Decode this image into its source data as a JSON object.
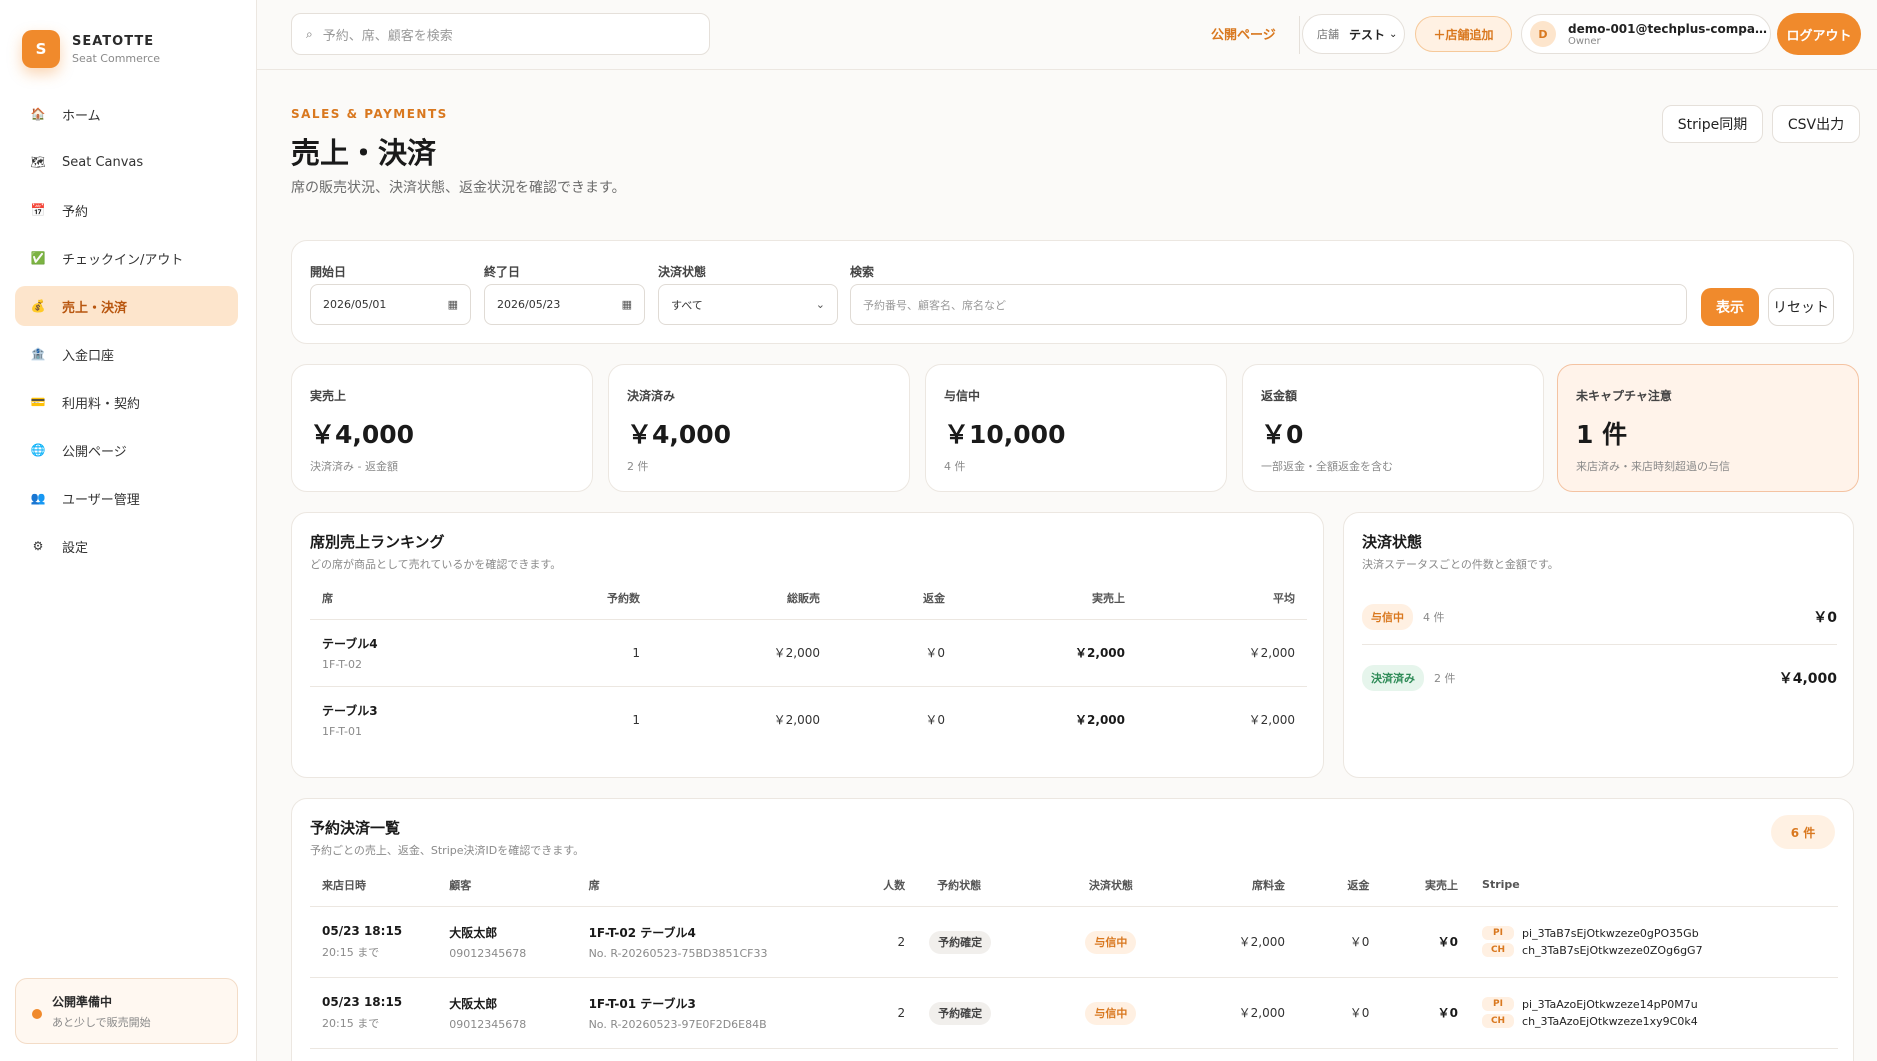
{
  "brand": {
    "logo_letter": "S",
    "name": "SEATOTTE",
    "sub": "Seat Commerce"
  },
  "nav": [
    {
      "label": "ホーム",
      "icon": "home-icon",
      "glyph": "🏠"
    },
    {
      "label": "Seat Canvas",
      "icon": "map-icon",
      "glyph": "🗺"
    },
    {
      "label": "予約",
      "icon": "calendar-icon",
      "glyph": "📅"
    },
    {
      "label": "チェックイン/アウト",
      "icon": "check-icon",
      "glyph": "✅"
    },
    {
      "label": "売上・決済",
      "icon": "money-bag-icon",
      "glyph": "💰",
      "active": true
    },
    {
      "label": "入金口座",
      "icon": "bank-icon",
      "glyph": "🏦"
    },
    {
      "label": "利用料・契約",
      "icon": "credit-card-icon",
      "glyph": "💳"
    },
    {
      "label": "公開ページ",
      "icon": "globe-icon",
      "glyph": "🌐"
    },
    {
      "label": "ユーザー管理",
      "icon": "users-icon",
      "glyph": "👥"
    },
    {
      "label": "設定",
      "icon": "gear-icon",
      "glyph": "⚙"
    }
  ],
  "publish_status": {
    "title": "公開準備中",
    "sub": "あと少しで販売開始"
  },
  "topbar": {
    "search_placeholder": "予約、席、顧客を検索",
    "public_page": "公開ページ",
    "store_label": "店舗",
    "store_value": "テスト",
    "add_store": "＋店舗追加",
    "user_initial": "D",
    "user_email": "demo-001@techplus-compan...",
    "user_role": "Owner",
    "logout": "ログアウト"
  },
  "header": {
    "eyebrow": "SALES & PAYMENTS",
    "title": "売上・決済",
    "desc": "席の販売状況、決済状態、返金状況を確認できます。",
    "stripe_sync": "Stripe同期",
    "csv_export": "CSV出力"
  },
  "filter": {
    "start_label": "開始日",
    "start_value": "2026/05/01",
    "end_label": "終了日",
    "end_value": "2026/05/23",
    "status_label": "決済状態",
    "status_value": "すべて",
    "search_label": "検索",
    "search_placeholder": "予約番号、顧客名、席名など",
    "show": "表示",
    "reset": "リセット"
  },
  "stats": [
    {
      "label": "実売上",
      "value": "￥4,000",
      "sub": "決済済み - 返金額"
    },
    {
      "label": "決済済み",
      "value": "￥4,000",
      "sub": "2 件"
    },
    {
      "label": "与信中",
      "value": "￥10,000",
      "sub": "4 件"
    },
    {
      "label": "返金額",
      "value": "￥0",
      "sub": "一部返金・全額返金を含む"
    },
    {
      "label": "未キャプチャ注意",
      "value": "1 件",
      "sub": "来店済み・来店時刻超過の与信"
    }
  ],
  "ranking": {
    "title": "席別売上ランキング",
    "desc": "どの席が商品として売れているかを確認できます。",
    "headers": [
      "席",
      "予約数",
      "総販売",
      "返金",
      "実売上",
      "平均"
    ],
    "rows": [
      {
        "name": "テーブル4",
        "code": "1F-T-02",
        "count": "1",
        "gross": "￥2,000",
        "refund": "￥0",
        "net": "￥2,000",
        "avg": "￥2,000"
      },
      {
        "name": "テーブル3",
        "code": "1F-T-01",
        "count": "1",
        "gross": "￥2,000",
        "refund": "￥0",
        "net": "￥2,000",
        "avg": "￥2,000"
      }
    ]
  },
  "payment_status": {
    "title": "決済状態",
    "desc": "決済ステータスごとの件数と金額です。",
    "rows": [
      {
        "label": "与信中",
        "count": "4 件",
        "amount": "￥0",
        "color": "orange"
      },
      {
        "label": "決済済み",
        "count": "2 件",
        "amount": "￥4,000",
        "color": "green"
      }
    ]
  },
  "list": {
    "title": "予約決済一覧",
    "desc": "予約ごとの売上、返金、Stripe決済IDを確認できます。",
    "count": "6 件",
    "headers": [
      "来店日時",
      "顧客",
      "席",
      "人数",
      "予約状態",
      "決済状態",
      "席料金",
      "返金",
      "実売上",
      "Stripe"
    ],
    "rows": [
      {
        "date": "05/23 18:15",
        "until": "20:15 まで",
        "customer": "大阪太郎",
        "phone": "09012345678",
        "seat": "1F-T-02 テーブル4",
        "resno": "No. R-20260523-75BD3851CF33",
        "people": "2",
        "res_status": "予約確定",
        "pay_status": "与信中",
        "fee": "￥2,000",
        "refund": "￥0",
        "net": "￥0",
        "pi_tag": "PI",
        "pi": "pi_3TaB7sEjOtkwzeze0gPO35Gb",
        "ch_tag": "CH",
        "ch": "ch_3TaB7sEjOtkwzeze0ZOg6gG7"
      },
      {
        "date": "05/23 18:15",
        "until": "20:15 まで",
        "customer": "大阪太郎",
        "phone": "09012345678",
        "seat": "1F-T-01 テーブル3",
        "resno": "No. R-20260523-97E0F2D6E84B",
        "people": "2",
        "res_status": "予約確定",
        "pay_status": "与信中",
        "fee": "￥2,000",
        "refund": "￥0",
        "net": "￥0",
        "pi_tag": "PI",
        "pi": "pi_3TaAzoEjOtkwzeze14pP0M7u",
        "ch_tag": "CH",
        "ch": "ch_3TaAzoEjOtkwzeze1xy9C0k4"
      }
    ]
  },
  "colors": {
    "accent": "#f08a2c",
    "accent_text": "#d9781f",
    "active_nav_bg": "#fde5cc"
  }
}
